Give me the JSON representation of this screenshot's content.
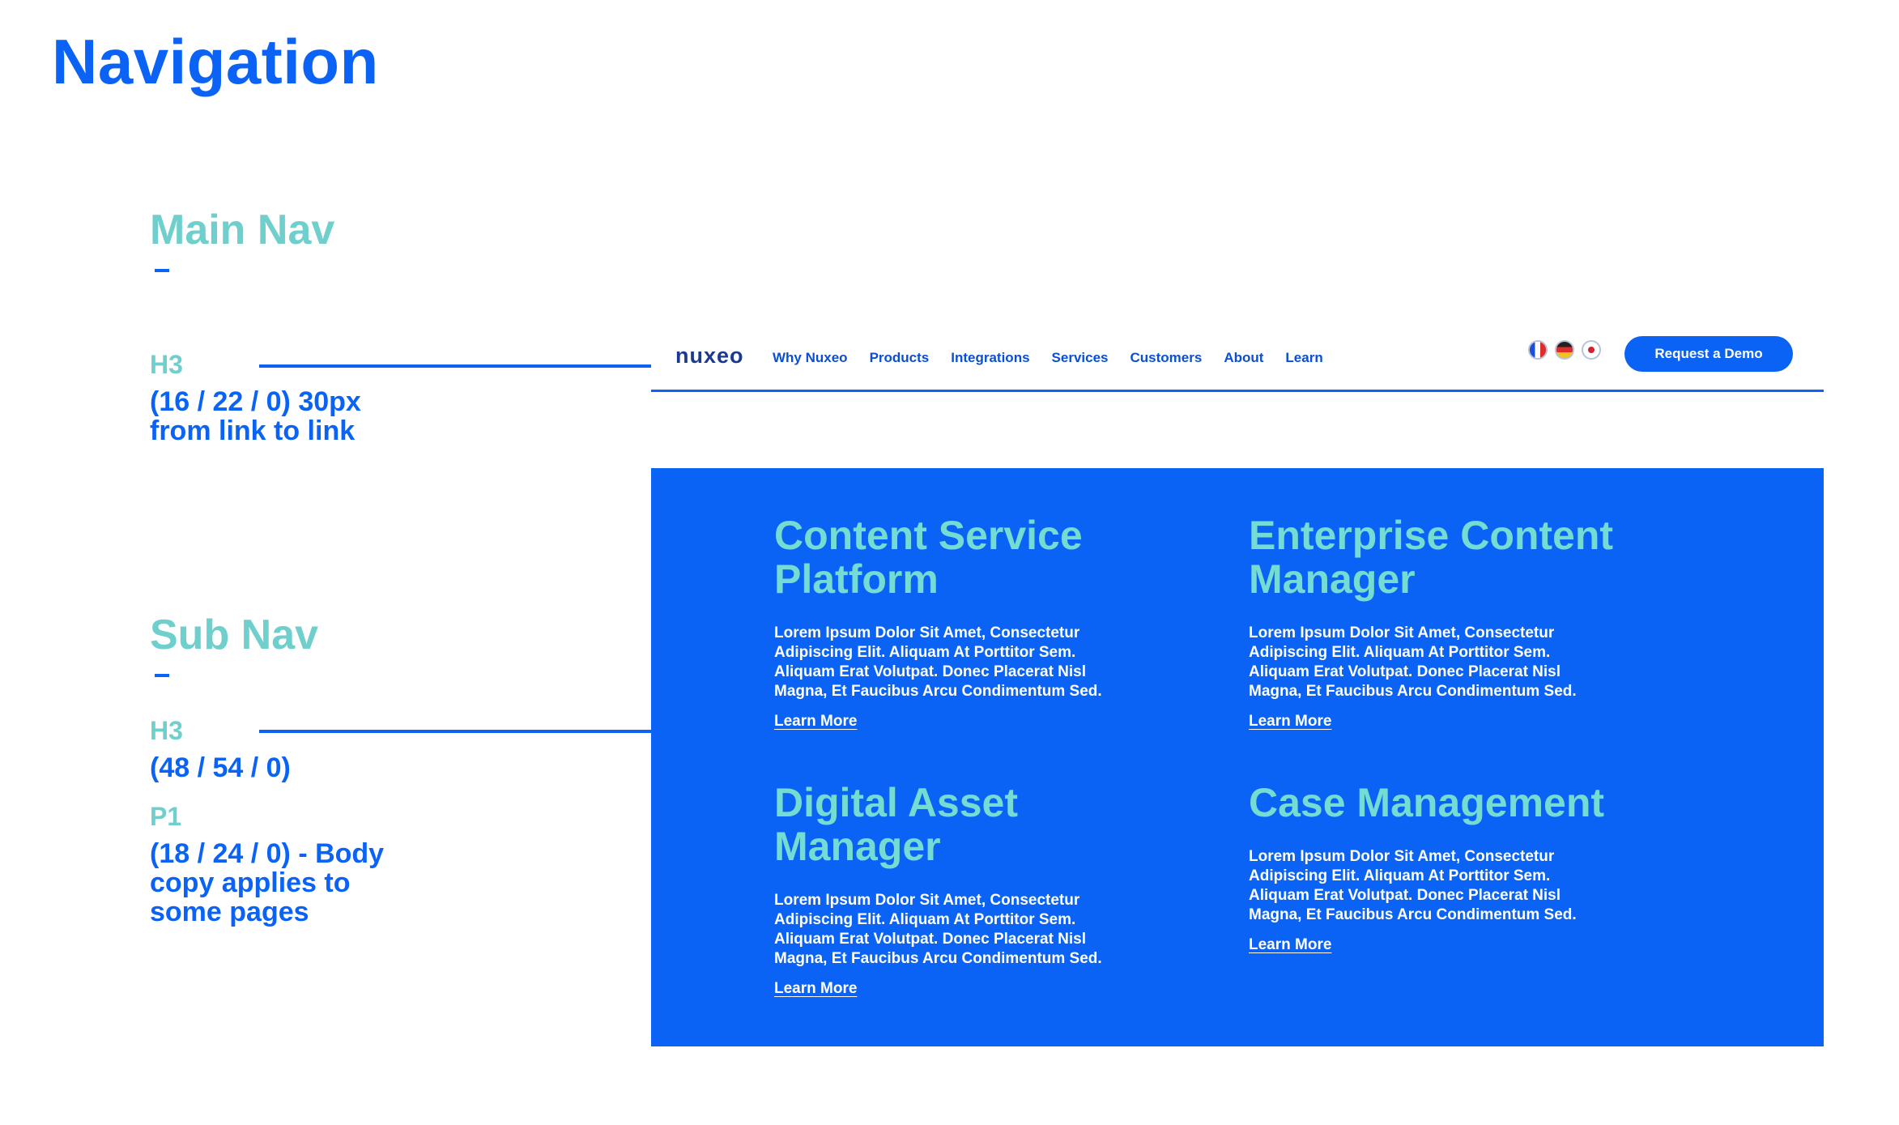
{
  "page": {
    "title": "Navigation"
  },
  "main_nav_spec": {
    "title": "Main Nav",
    "tag": "H3",
    "spec": "(16 / 22 / 0) 30px from link to link"
  },
  "sub_nav_spec": {
    "title": "Sub Nav",
    "h3_tag": "H3",
    "h3_spec": "(48 / 54 / 0)",
    "p1_tag": "P1",
    "p1_spec": "(18 / 24 / 0) - Body copy applies to some pages"
  },
  "main_nav": {
    "logo": "nuxeo",
    "links": [
      "Why Nuxeo",
      "Products",
      "Integrations",
      "Services",
      "Customers",
      "About",
      "Learn"
    ],
    "flags": [
      "flag-france-icon",
      "flag-germany-icon",
      "flag-japan-icon"
    ],
    "cta": "Request a Demo"
  },
  "sub_nav": {
    "cards": [
      {
        "title": "Content Service Platform",
        "body": "Lorem Ipsum Dolor Sit Amet, Consectetur Adipiscing Elit. Aliquam At Porttitor Sem. Aliquam Erat Volutpat. Donec Placerat Nisl Magna, Et Faucibus Arcu Condimentum Sed.",
        "link": "Learn More"
      },
      {
        "title": "Enterprise Content Manager",
        "body": "Lorem Ipsum Dolor Sit Amet, Consectetur Adipiscing Elit. Aliquam At Porttitor Sem. Aliquam Erat Volutpat. Donec Placerat Nisl Magna, Et Faucibus Arcu Condimentum Sed.",
        "link": "Learn More"
      },
      {
        "title": "Digital Asset Manager",
        "body": "Lorem Ipsum Dolor Sit Amet, Consectetur Adipiscing Elit. Aliquam At Porttitor Sem. Aliquam Erat Volutpat. Donec Placerat Nisl Magna, Et Faucibus Arcu Condimentum Sed.",
        "link": "Learn More"
      },
      {
        "title": "Case Management",
        "body": "Lorem Ipsum Dolor Sit Amet, Consectetur Adipiscing Elit. Aliquam At Porttitor Sem. Aliquam Erat Volutpat. Donec Placerat Nisl Magna, Et Faucibus Arcu Condimentum Sed.",
        "link": "Learn More"
      }
    ]
  },
  "colors": {
    "brand_blue": "#0b63f6",
    "teal": "#6fcfcc",
    "card_title_teal": "#74dcd2",
    "white": "#ffffff"
  }
}
